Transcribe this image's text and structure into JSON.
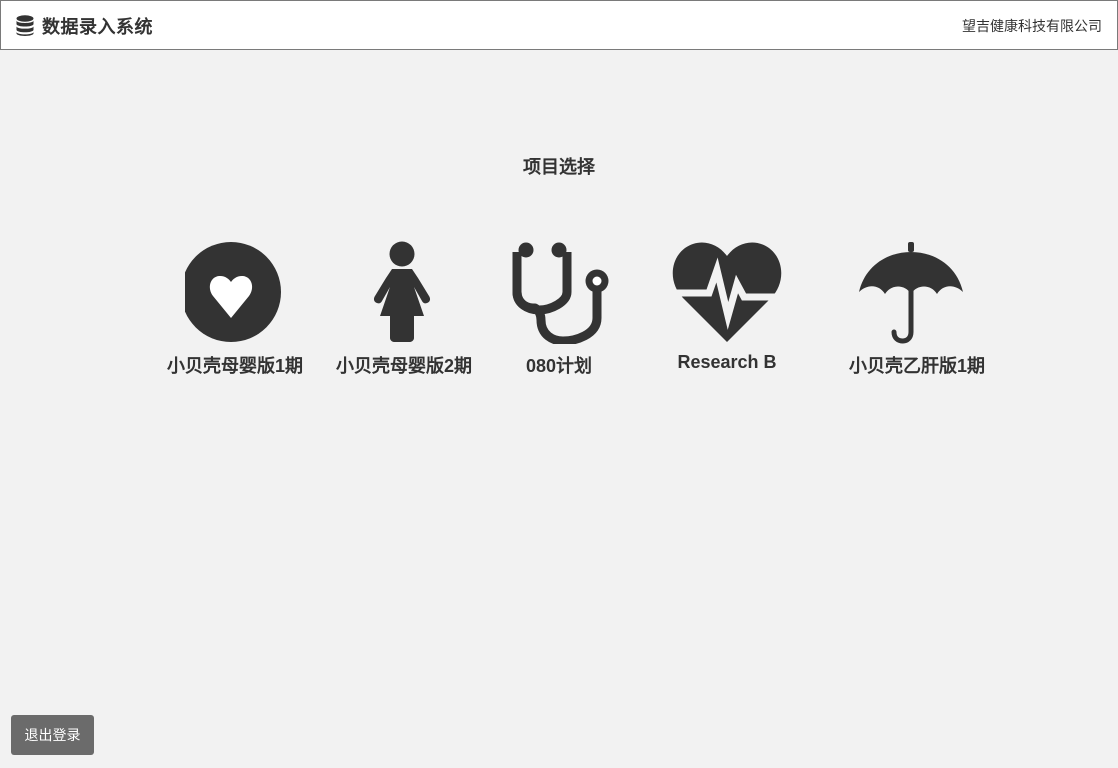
{
  "header": {
    "title": "数据录入系统",
    "company": "望吉健康科技有限公司",
    "logo_icon": "database-icon"
  },
  "main": {
    "section_title": "项目选择",
    "projects": [
      {
        "label": "小贝壳母婴版1期",
        "icon": "heart-circle-icon"
      },
      {
        "label": "小贝壳母婴版2期",
        "icon": "female-icon"
      },
      {
        "label": "080计划",
        "icon": "stethoscope-icon"
      },
      {
        "label": "Research B",
        "icon": "heartbeat-icon"
      },
      {
        "label": "小贝壳乙肝版1期",
        "icon": "umbrella-icon"
      }
    ]
  },
  "footer": {
    "logout_label": "退出登录"
  },
  "colors": {
    "background": "#f2f2f2",
    "icon": "#333333",
    "logout_button": "#6b6b6b",
    "header_border": "#7a7a7a"
  }
}
